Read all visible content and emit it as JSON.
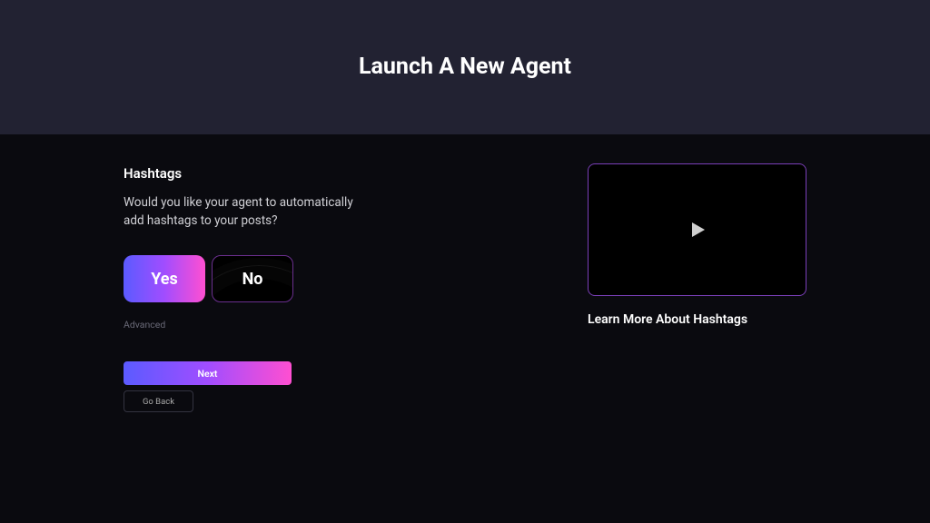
{
  "header": {
    "title": "Launch A New Agent"
  },
  "section": {
    "title": "Hashtags",
    "prompt": "Would you like your agent to automatically add hashtags to your posts?"
  },
  "toggle": {
    "yes": "Yes",
    "no": "No"
  },
  "advanced_label": "Advanced",
  "nav": {
    "next": "Next",
    "back": "Go Back"
  },
  "media": {
    "caption": "Learn More About Hashtags"
  }
}
